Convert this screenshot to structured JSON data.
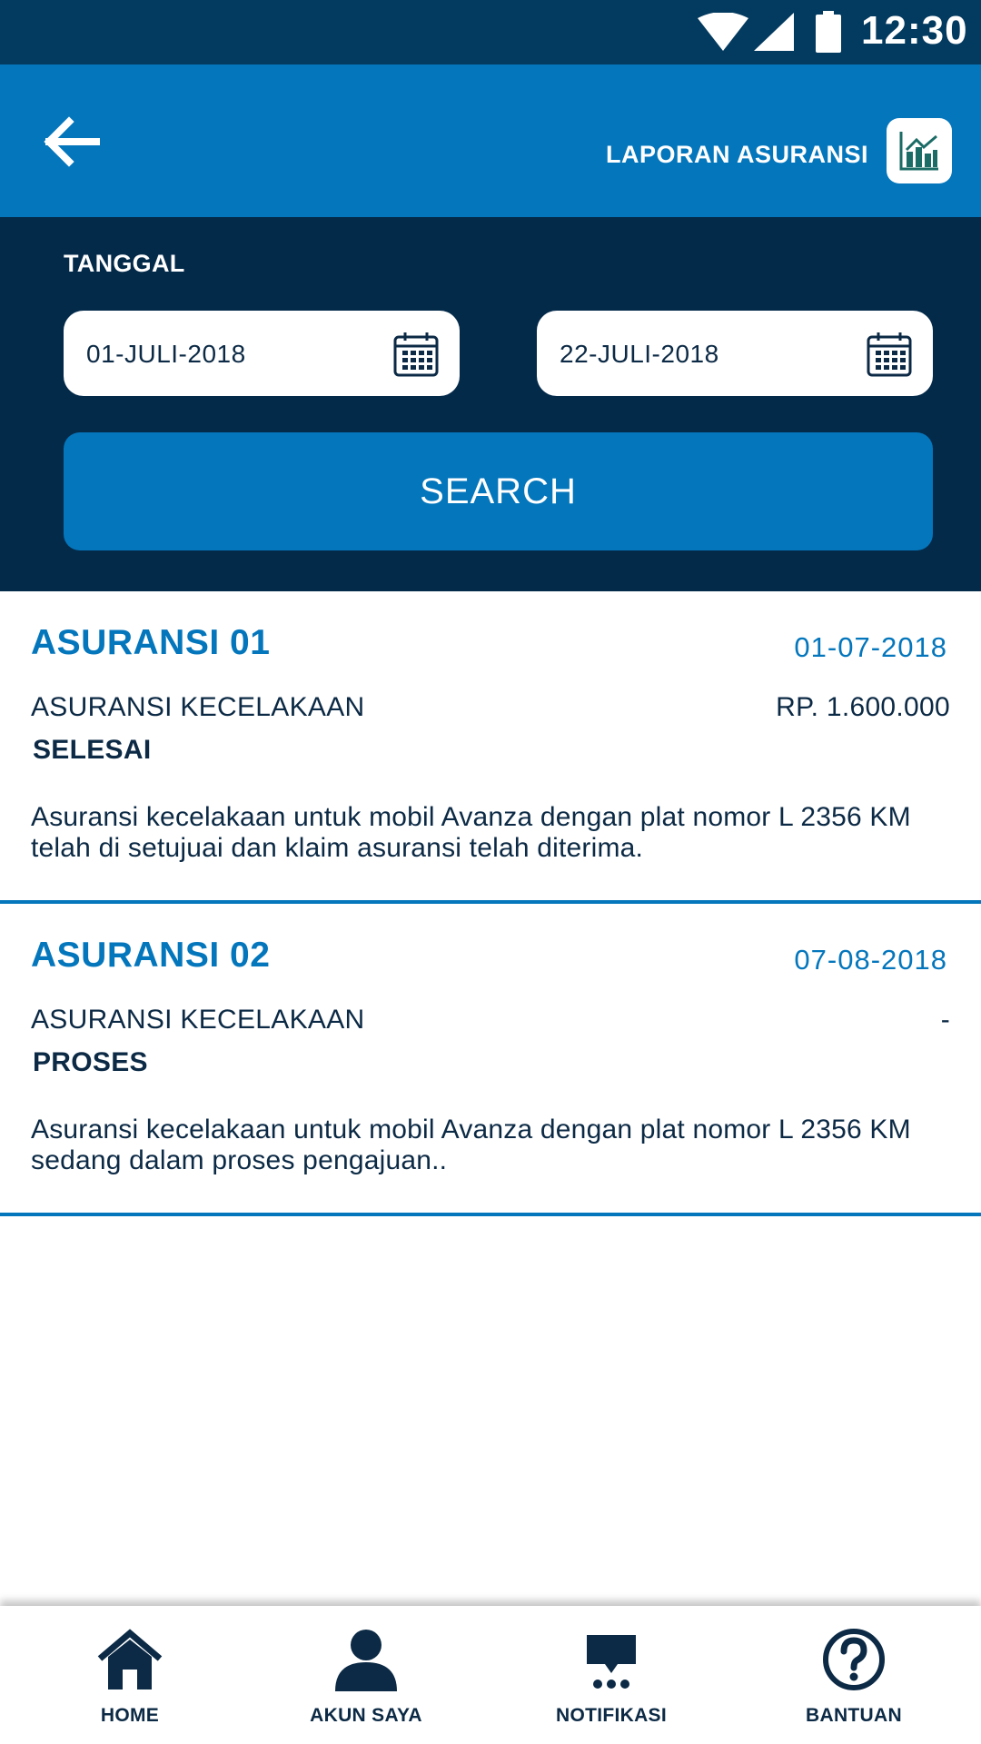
{
  "status_bar": {
    "time": "12:30",
    "icons": [
      "wifi-icon",
      "cellular-signal-icon",
      "battery-icon"
    ]
  },
  "header": {
    "back_icon": "arrow-left-icon",
    "title": "LAPORAN ASURANSI",
    "action_icon": "bar-chart-icon"
  },
  "filter": {
    "label": "TANGGAL",
    "date_from": "01-JULI-2018",
    "date_to": "22-JULI-2018",
    "calendar_icon": "calendar-icon",
    "search_label": "SEARCH"
  },
  "reports": [
    {
      "name": "ASURANSI 01",
      "date": "01-07-2018",
      "type": "ASURANSI KECELAKAAN",
      "amount": "RP. 1.600.000",
      "status": "SELESAI",
      "description": "Asuransi kecelakaan untuk mobil Avanza dengan plat nomor L 2356 KM telah di setujuai dan klaim asuransi telah diterima."
    },
    {
      "name": "ASURANSI 02",
      "date": "07-08-2018",
      "type": "ASURANSI KECELAKAAN",
      "amount": "-",
      "status": "PROSES",
      "description": "Asuransi kecelakaan untuk mobil Avanza dengan plat nomor L 2356 KM sedang dalam proses pengajuan.."
    }
  ],
  "bottom_nav": {
    "items": [
      {
        "label": "HOME",
        "icon": "home-icon"
      },
      {
        "label": "AKUN SAYA",
        "icon": "user-icon"
      },
      {
        "label": "NOTIFIKASI",
        "icon": "chat-bubble-icon"
      },
      {
        "label": "BANTUAN",
        "icon": "help-icon"
      }
    ]
  },
  "colors": {
    "status_bar": "#033a5f",
    "primary": "#0476bc",
    "filter_bg": "#042a4a",
    "text_dark": "#0c2a45",
    "chart_icon": "#1b6b66"
  }
}
